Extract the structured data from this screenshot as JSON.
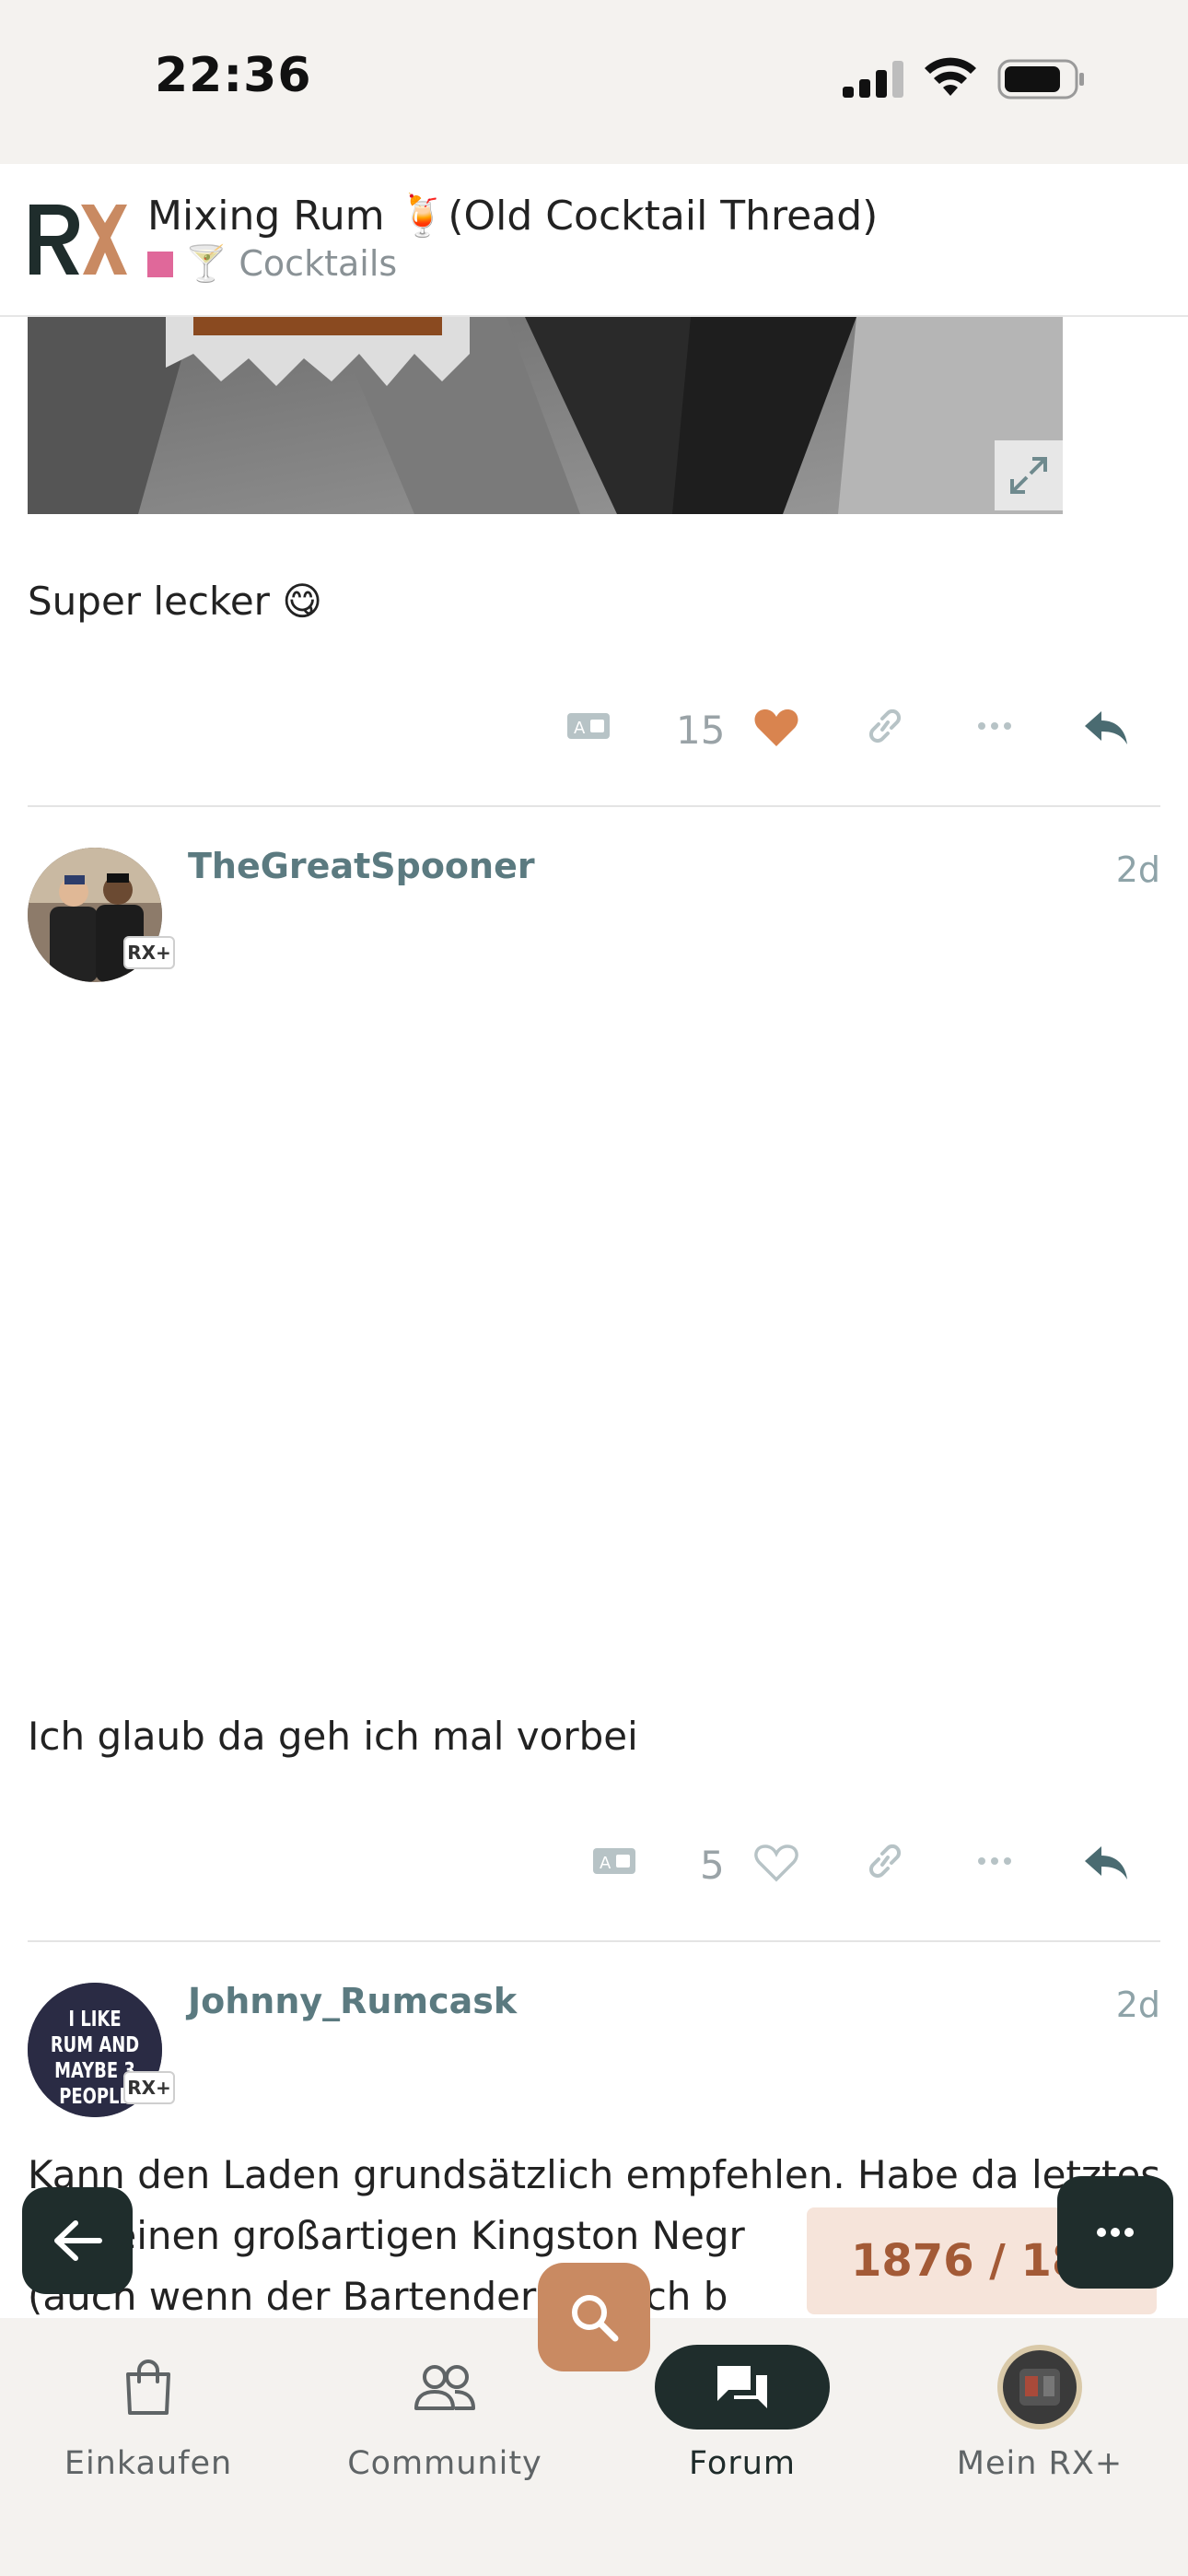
{
  "status_bar": {
    "time": "22:36"
  },
  "topic": {
    "title": "Mixing Rum 🍹(Old Cocktail Thread)",
    "category": "🍸 Cocktails",
    "category_color": "#e0689a"
  },
  "posts": [
    {
      "text": "Super lecker 😋",
      "likes": "15",
      "liked": true
    },
    {
      "username": "TheGreatSpooner",
      "date": "2d",
      "badge": "RX+",
      "text": "Ich glaub da geh ich mal vorbei",
      "likes": "5",
      "liked": false
    },
    {
      "username": "Johnny_Rumcask",
      "date": "2d",
      "badge": "RX+",
      "avatar_text": "I LIKE RUM AND MAYBE 3 PEOPLE",
      "text_lines": [
        "Kann den Laden grundsätzlich empfehlen. Habe da letztes",
        "u.a. einen großartigen Kingston Negr",
        "(auch wenn der Bartender e, mich b"
      ]
    }
  ],
  "progress": "1876 / 18",
  "tabs": [
    {
      "label": "Einkaufen",
      "icon": "shopping-bag-icon"
    },
    {
      "label": "Community",
      "icon": "people-icon"
    },
    {
      "label": "Forum",
      "icon": "chat-bubbles-icon",
      "active": true
    },
    {
      "label": "Mein RX+",
      "icon": "profile-avatar-icon"
    }
  ],
  "colors": {
    "accent": "#c98a62",
    "dark": "#1f2d2c",
    "heart": "#d9844f",
    "username": "#5b7a80"
  }
}
